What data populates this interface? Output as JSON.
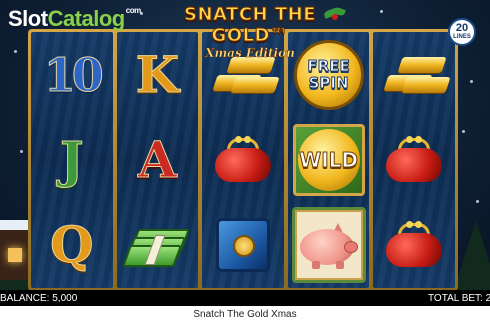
{
  "watermark": {
    "slot": "Slot",
    "catalog": "Catalog",
    "tm": "com"
  },
  "game": {
    "title": "SNATCH THE GOLD",
    "title_mark": "™",
    "subtitle": "Xmas Edition",
    "lines": {
      "count": "20",
      "label": "LINES"
    }
  },
  "reels": [
    [
      "ten",
      "jack",
      "queen"
    ],
    [
      "king",
      "ace",
      "cash-stack"
    ],
    [
      "gold-bars",
      "red-purse",
      "blue-safe"
    ],
    [
      "free-spin",
      "wild",
      "piggy-bank"
    ],
    [
      "gold-bars",
      "red-purse",
      "red-purse"
    ]
  ],
  "symbols": {
    "ten": "10",
    "jack": "J",
    "queen": "Q",
    "king": "K",
    "ace": "A",
    "free_spin_line1": "FREE",
    "free_spin_line2": "SPIN",
    "wild": "WILD"
  },
  "status": {
    "balance_label": "BALANCE:",
    "balance_value": "5,000",
    "total_bet_label": "TOTAL BET:",
    "total_bet_value": "2"
  },
  "footer": {
    "title": "Snatch The Gold Xmas"
  },
  "colors": {
    "accent_gold": "#d4a647",
    "reel_blue": "#0d2c52",
    "brand_green": "#8ad14a"
  }
}
